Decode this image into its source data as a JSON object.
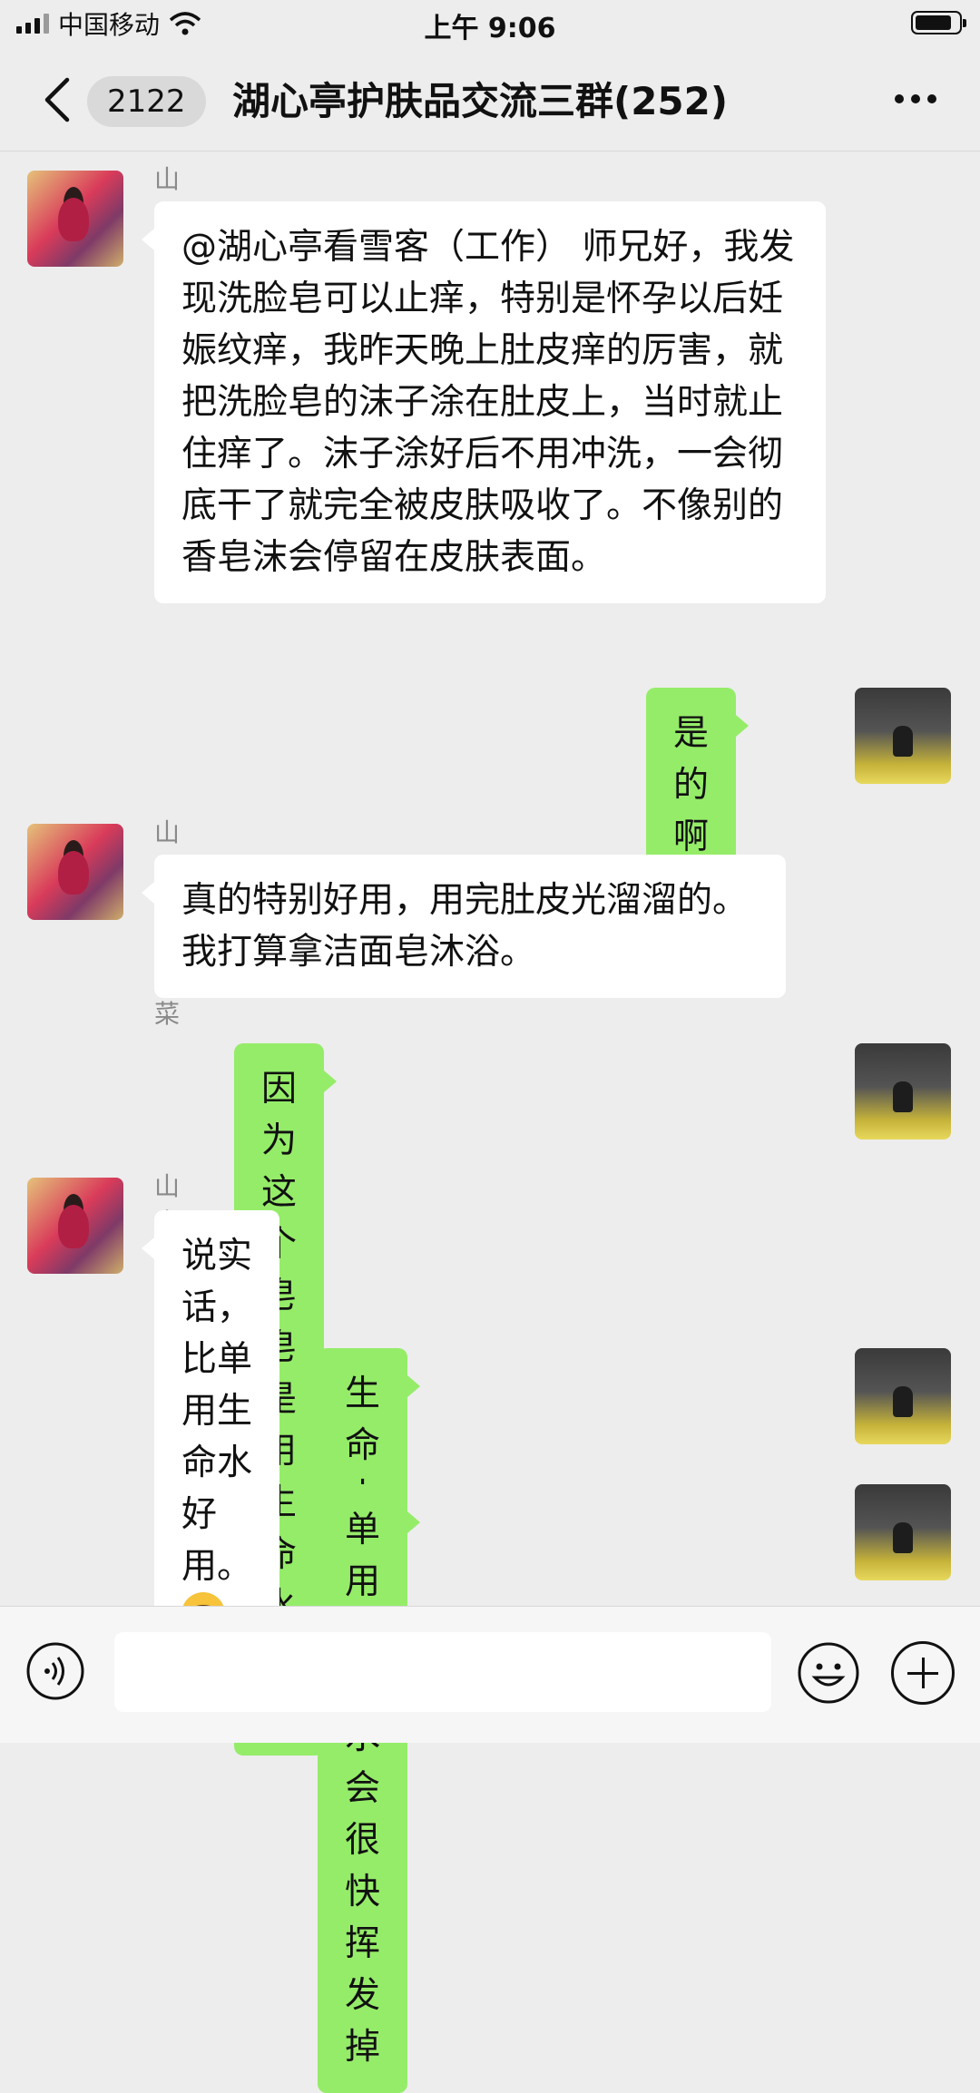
{
  "status_bar": {
    "carrier": "中国移动",
    "time": "上午 9:06",
    "battery_level_fraction": 0.85
  },
  "header": {
    "unread_badge": "2122",
    "title": "湖心亭护肤品交流三群(252)"
  },
  "messages": [
    {
      "direction": "in",
      "sender": "山大王吃白菜",
      "text": "@湖心亭看雪客（工作） 师兄好，我发现洗脸皂可以止痒，特别是怀孕以后妊娠纹痒，我昨天晚上肚皮痒的厉害，就把洗脸皂的沫子涂在肚皮上，当时就止住痒了。沫子涂好后不用冲洗，一会彻底干了就完全被皮肤吸收了。不像别的香皂沫会停留在皮肤表面。"
    },
    {
      "direction": "out",
      "text": "是的啊"
    },
    {
      "direction": "in",
      "sender": "山大王吃白菜",
      "text": "真的特别好用，用完肚皮光溜溜的。我打算拿洁面皂沐浴。"
    },
    {
      "direction": "out",
      "text": "因为这个皂皂是用生命水做的"
    },
    {
      "direction": "in",
      "sender": "山大王吃白菜",
      "text": "说实话，比单用生命水好用。",
      "emoji": "laughing-crying-emoji"
    },
    {
      "direction": "out",
      "text": "生命水凝聚多种植物精华"
    },
    {
      "direction": "out",
      "text": "单用生命水会很快挥发掉"
    }
  ],
  "icons": {
    "back": "chevron-left-icon",
    "more": "more-dots-icon",
    "voice": "voice-icon",
    "emoji": "emoji-icon",
    "plus": "plus-icon"
  },
  "colors": {
    "background": "#ededed",
    "outgoing_bubble": "#95ec69",
    "incoming_bubble": "#ffffff"
  }
}
